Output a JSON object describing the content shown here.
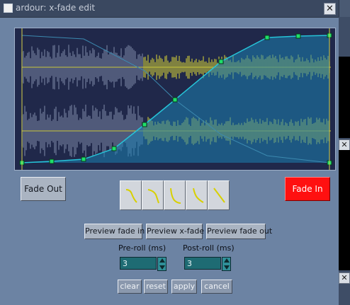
{
  "window": {
    "title": "ardour: x-fade edit",
    "close_glyph": "✕"
  },
  "strip": {
    "close_glyph": "✕"
  },
  "waveform": {
    "top_color": "#c9c63a",
    "bottom_color": "#c9c63a",
    "left_color": "#7f8aa8",
    "curve_color": "#26c4d8",
    "point_color": "#1ee06a",
    "fill_color": "#1c7fb0"
  },
  "buttons": {
    "fade_out": "Fade Out",
    "fade_in": "Fade In",
    "preview_fade_in": "Preview fade in",
    "preview_xfade": "Preview x-fade",
    "preview_fade_out": "Preview fade out",
    "clear": "clear",
    "reset": "reset",
    "apply": "apply",
    "cancel": "cancel"
  },
  "shape_presets": [
    {
      "icon": "fade-shape-concave-icon"
    },
    {
      "icon": "fade-shape-convex-icon"
    },
    {
      "icon": "fade-shape-slow-icon"
    },
    {
      "icon": "fade-shape-fast-icon"
    },
    {
      "icon": "fade-shape-linear-icon"
    }
  ],
  "preroll": {
    "label": "Pre-roll (ms)",
    "value": "3"
  },
  "postroll": {
    "label": "Post-roll (ms)",
    "value": "3"
  },
  "colors": {
    "active_fade": "#ff1010"
  }
}
